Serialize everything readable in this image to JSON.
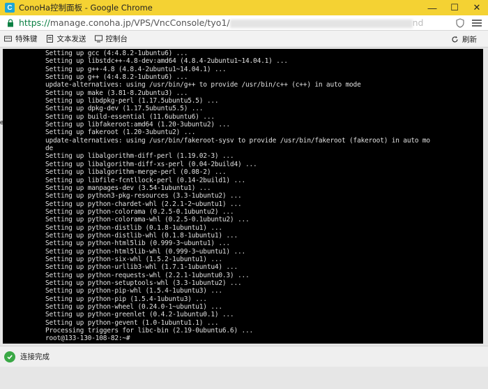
{
  "window": {
    "title": "ConoHa控制面板 - Google Chrome",
    "app_icon_letter": "C",
    "controls": {
      "minimize": "—",
      "maximize": "☐",
      "close": "✕"
    }
  },
  "address_bar": {
    "scheme": "https://",
    "host_path": "manage.conoha.jp/VPS/VncConsole/tyo1/",
    "tail": "nd"
  },
  "toolbar": {
    "items": [
      "特殊键",
      "文本发送",
      "控制台"
    ],
    "refresh_label": "刷新"
  },
  "terminal": {
    "lines": [
      "Setting up gcc (4:4.8.2-1ubuntu6) ...",
      "Setting up libstdc++-4.8-dev:amd64 (4.8.4-2ubuntu1~14.04.1) ...",
      "Setting up g++-4.8 (4.8.4-2ubuntu1~14.04.1) ...",
      "Setting up g++ (4:4.8.2-1ubuntu6) ...",
      "update-alternatives: using /usr/bin/g++ to provide /usr/bin/c++ (c++) in auto mode",
      "Setting up make (3.81-8.2ubuntu3) ...",
      "Setting up libdpkg-perl (1.17.5ubuntu5.5) ...",
      "Setting up dpkg-dev (1.17.5ubuntu5.5) ...",
      "Setting up build-essential (11.6ubuntu6) ...",
      "Setting up libfakeroot:amd64 (1.20-3ubuntu2) ...",
      "Setting up fakeroot (1.20-3ubuntu2) ...",
      "update-alternatives: using /usr/bin/fakeroot-sysv to provide /usr/bin/fakeroot (fakeroot) in auto mo",
      "de",
      "Setting up libalgorithm-diff-perl (1.19.02-3) ...",
      "Setting up libalgorithm-diff-xs-perl (0.04-2build4) ...",
      "Setting up libalgorithm-merge-perl (0.08-2) ...",
      "Setting up libfile-fcntllock-perl (0.14-2build1) ...",
      "Setting up manpages-dev (3.54-1ubuntu1) ...",
      "Setting up python3-pkg-resources (3.3-1ubuntu2) ...",
      "Setting up python-chardet-whl (2.2.1-2~ubuntu1) ...",
      "Setting up python-colorama (0.2.5-0.1ubuntu2) ...",
      "Setting up python-colorama-whl (0.2.5-0.1ubuntu2) ...",
      "Setting up python-distlib (0.1.8-1ubuntu1) ...",
      "Setting up python-distlib-whl (0.1.8-1ubuntu1) ...",
      "Setting up python-html5lib (0.999-3~ubuntu1) ...",
      "Setting up python-html5lib-whl (0.999-3~ubuntu1) ...",
      "Setting up python-six-whl (1.5.2-1ubuntu1) ...",
      "Setting up python-urllib3-whl (1.7.1-1ubuntu4) ...",
      "Setting up python-requests-whl (2.2.1-1ubuntu0.3) ...",
      "Setting up python-setuptools-whl (3.3-1ubuntu2) ...",
      "Setting up python-pip-whl (1.5.4-1ubuntu3) ...",
      "Setting up python-pip (1.5.4-1ubuntu3) ...",
      "Setting up python-wheel (0.24.0-1~ubuntu1) ...",
      "Setting up python-greenlet (0.4.2-1ubuntu0.1) ...",
      "Setting up python-gevent (1.0-1ubuntu1.1) ...",
      "Processing triggers for libc-bin (2.19-0ubuntu6.6) ...",
      "root@133-130-108-82:~# "
    ]
  },
  "side_strip": {
    "chars": "er"
  },
  "status": {
    "text": "连接完成",
    "color": "#3aa845"
  },
  "colors": {
    "titlebar": "#f4d233",
    "terminal_bg": "#000000",
    "terminal_fg": "#e0e0e0"
  }
}
